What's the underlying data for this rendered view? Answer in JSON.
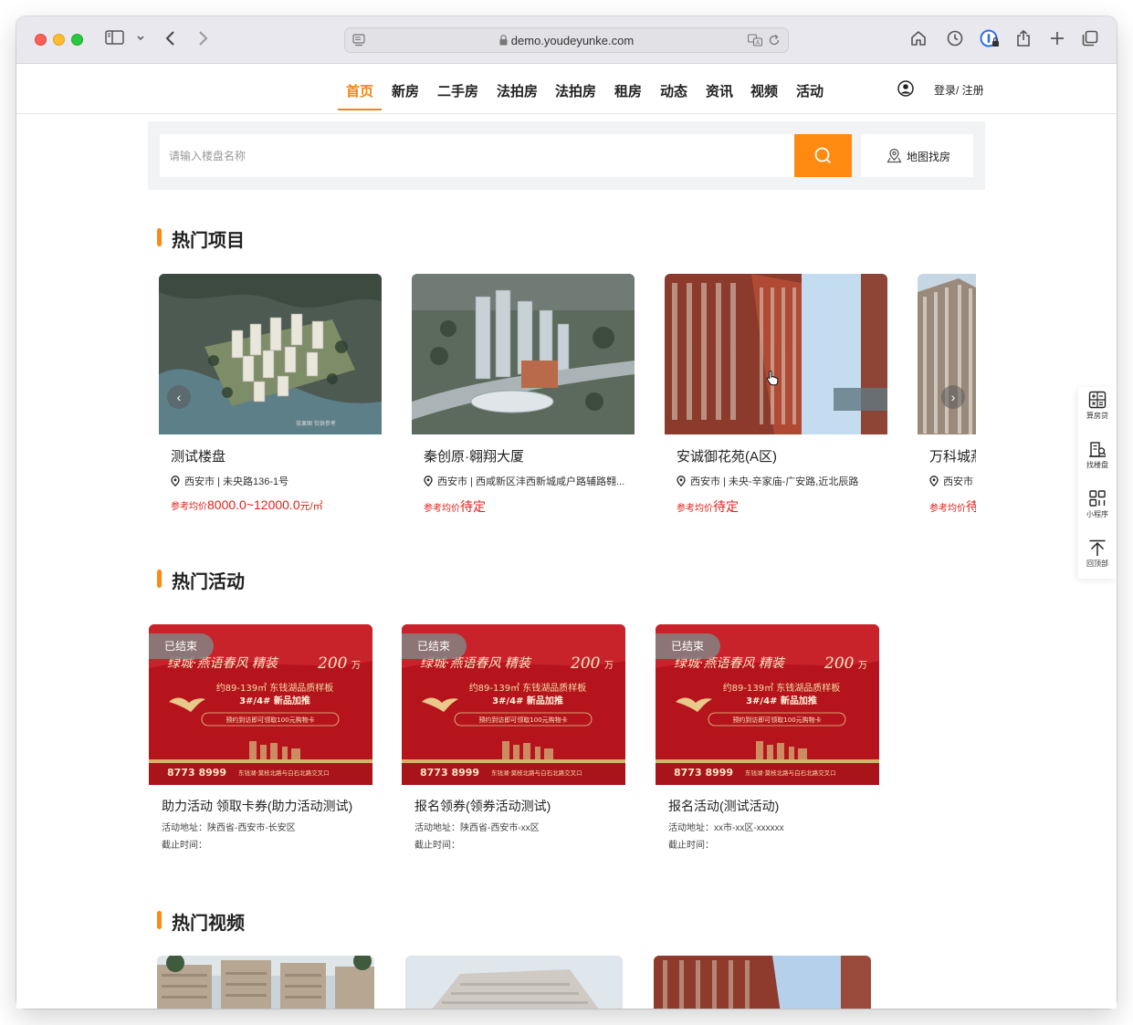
{
  "browser": {
    "url": "demo.youdeyunke.com"
  },
  "nav": {
    "items": [
      {
        "label": "首页",
        "active": true
      },
      {
        "label": "新房"
      },
      {
        "label": "二手房"
      },
      {
        "label": "法拍房"
      },
      {
        "label": "法拍房"
      },
      {
        "label": "租房"
      },
      {
        "label": "动态"
      },
      {
        "label": "资讯"
      },
      {
        "label": "视频"
      },
      {
        "label": "活动"
      }
    ],
    "login_label": "登录/ 注册"
  },
  "search": {
    "placeholder": "请输入楼盘名称",
    "map_label": "地图找房"
  },
  "hot_projects": {
    "title": "热门项目",
    "items": [
      {
        "name": "测试楼盘",
        "address": "西安市 | 未央路136-1号",
        "price_label": "参考均价",
        "price": "8000.0~12000.0",
        "unit": "元/㎡"
      },
      {
        "name": "秦创原·翱翔大厦",
        "address": "西安市 | 西咸新区沣西新城咸户路辅路翱...",
        "price_label": "参考均价",
        "price": "待定",
        "unit": ""
      },
      {
        "name": "安诚御花苑(A区)",
        "address": "西安市 | 未央-辛家庙-广安路,近北辰路",
        "price_label": "参考均价",
        "price": "待定",
        "unit": ""
      },
      {
        "name": "万科城燕",
        "address": "西安市",
        "price_label": "参考均价",
        "price": "待定",
        "unit": ""
      }
    ]
  },
  "hot_activities": {
    "title": "热门活动",
    "items": [
      {
        "badge": "已结束",
        "name": "助力活动 领取卡券(助力活动测试)",
        "address": "活动地址：陕西省-西安市-长安区",
        "deadline": "截止时间："
      },
      {
        "badge": "已结束",
        "name": "报名领券(领券活动测试)",
        "address": "活动地址：陕西省-西安市-xx区",
        "deadline": "截止时间："
      },
      {
        "badge": "已结束",
        "name": "报名活动(测试活动)",
        "address": "活动地址：xx市-xx区-xxxxxx",
        "deadline": "截止时间："
      }
    ],
    "poster": {
      "headline": "绿城·燕语春风  精装",
      "price_big": "200",
      "price_unit": "万",
      "line2": "约89-139㎡ 东钱湖品质样板",
      "line3": "3#/4# 新品加推",
      "line4": "预约到访即可领取100元购物卡",
      "phone": "8773 8999",
      "location": "东钱湖·莫枝北路与白石北路交叉口"
    }
  },
  "hot_videos": {
    "title": "热门视频"
  },
  "sidebar": {
    "items": [
      {
        "label": "算房贷",
        "icon": "calculator-icon"
      },
      {
        "label": "找楼盘",
        "icon": "building-icon"
      },
      {
        "label": "小程序",
        "icon": "grid-icon"
      },
      {
        "label": "回顶部",
        "icon": "to-top-icon"
      }
    ]
  },
  "colors": {
    "accent": "#ff8a12",
    "price_red": "#e0211b",
    "poster_red": "#b5141c"
  }
}
